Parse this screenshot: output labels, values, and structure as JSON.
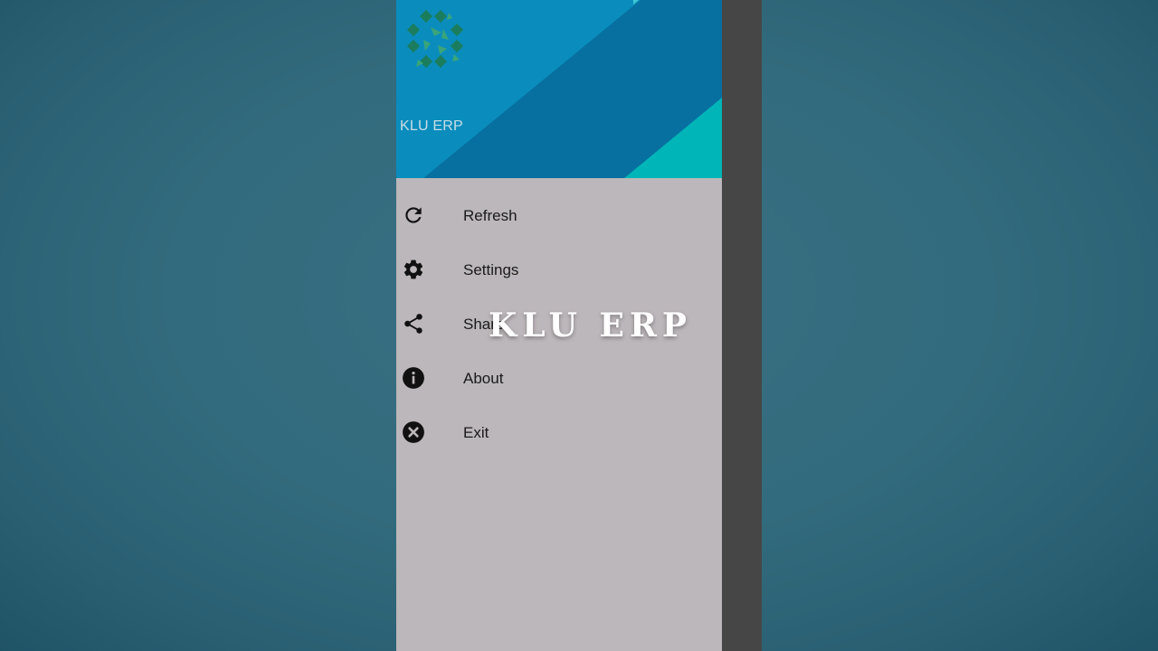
{
  "drawer": {
    "header_title": "KLU ERP",
    "logo_icon": "klu-logo-icon",
    "items": [
      {
        "label": "Refresh",
        "icon": "refresh-icon"
      },
      {
        "label": "Settings",
        "icon": "gear-icon"
      },
      {
        "label": "Share",
        "icon": "share-icon"
      },
      {
        "label": "About",
        "icon": "info-icon"
      },
      {
        "label": "Exit",
        "icon": "close-circle-icon"
      }
    ]
  },
  "overlay": {
    "title": "KLU ERP"
  },
  "colors": {
    "header_blue": "#0a8dbd",
    "header_dark_blue": "#0770a0",
    "header_teal": "#00b5b8",
    "drawer_bg": "#bcb7ba",
    "backdrop": "#336b7d"
  }
}
